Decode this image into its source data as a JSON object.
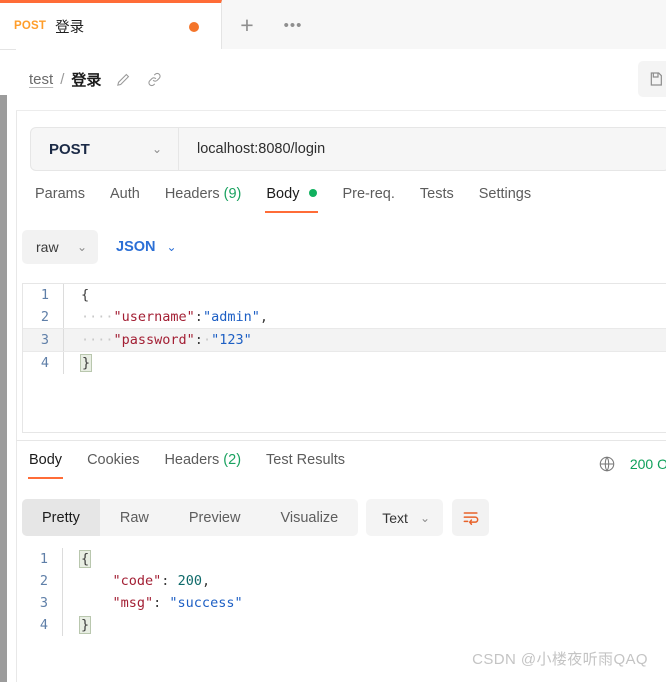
{
  "tabbar": {
    "active_tab": {
      "method": "POST",
      "title": "登录",
      "unsaved_dot": "unsaved"
    },
    "new_tab_icon": "+",
    "more_icon": "•••"
  },
  "breadcrumb": {
    "collection": "test",
    "separator": "/",
    "request_name": "登录",
    "edit_icon": "pencil-icon",
    "link_icon": "link-icon"
  },
  "url_bar": {
    "method": "POST",
    "chevron": "⌄",
    "url": "localhost:8080/login"
  },
  "request_tabs": [
    {
      "label": "Params",
      "active": false
    },
    {
      "label": "Auth",
      "active": false
    },
    {
      "label": "Headers",
      "count": "(9)",
      "active": false
    },
    {
      "label": "Body",
      "active": true,
      "dot": "green"
    },
    {
      "label": "Pre-req.",
      "active": false
    },
    {
      "label": "Tests",
      "active": false
    },
    {
      "label": "Settings",
      "active": false
    }
  ],
  "body_type": {
    "mode": "raw",
    "mode_chevron": "⌄",
    "format": "JSON",
    "format_chevron": "⌄"
  },
  "request_body": {
    "lines": [
      {
        "n": "1",
        "open_brace": "{"
      },
      {
        "n": "2",
        "indent": "····",
        "key": "\"username\"",
        "colon": ":",
        "value": "\"admin\"",
        "comma": ","
      },
      {
        "n": "3",
        "indent": "····",
        "key": "\"password\"",
        "colon": ":",
        "space": "·",
        "value": "\"123\"",
        "highlight": true
      },
      {
        "n": "4",
        "close_brace": "}"
      }
    ]
  },
  "response_tabs": [
    {
      "label": "Body",
      "active": true
    },
    {
      "label": "Cookies",
      "active": false
    },
    {
      "label": "Headers",
      "count": "(2)",
      "active": false
    },
    {
      "label": "Test Results",
      "active": false
    }
  ],
  "response_status": {
    "globe_icon": "globe-icon",
    "status": "200 O"
  },
  "response_toolbar": {
    "views": [
      {
        "label": "Pretty",
        "active": true
      },
      {
        "label": "Raw",
        "active": false
      },
      {
        "label": "Preview",
        "active": false
      },
      {
        "label": "Visualize",
        "active": false
      }
    ],
    "format": "Text",
    "format_chevron": "⌄",
    "wrap_icon": "word-wrap-icon"
  },
  "response_body": {
    "lines": [
      {
        "n": "1",
        "open_brace": "{"
      },
      {
        "n": "2",
        "indent": "    ",
        "key": "\"code\"",
        "colon": ":",
        "num": " 200",
        "comma": ","
      },
      {
        "n": "3",
        "indent": "    ",
        "key": "\"msg\"",
        "colon": ":",
        "value": " \"success\""
      },
      {
        "n": "4",
        "close_brace": "}"
      }
    ]
  },
  "watermark": "CSDN @小楼夜听雨QAQ",
  "colors": {
    "accent": "#ff6c37",
    "green": "#11b15f",
    "json_key": "#a31f34",
    "json_string": "#1d5fc4",
    "link_blue": "#2b6fd6"
  }
}
